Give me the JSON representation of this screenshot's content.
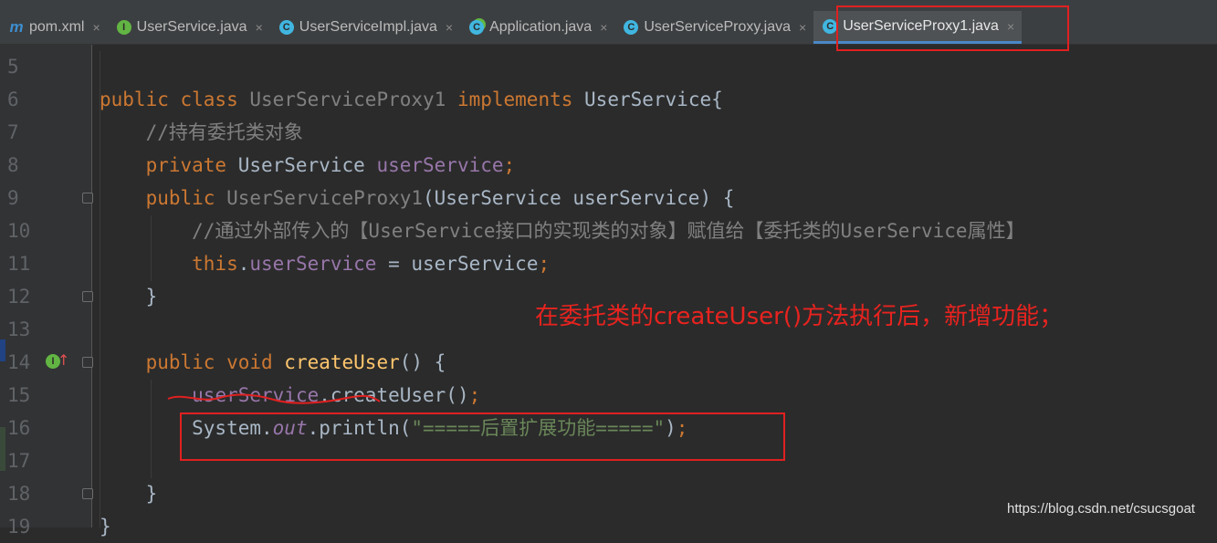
{
  "tabs": [
    {
      "label": "pom.xml",
      "icon": "maven-icon",
      "glyph": "m"
    },
    {
      "label": "UserService.java",
      "icon": "interface-icon",
      "glyph": "I"
    },
    {
      "label": "UserServiceImpl.java",
      "icon": "class-icon",
      "glyph": "C"
    },
    {
      "label": "Application.java",
      "icon": "spring-class-icon",
      "glyph": "C"
    },
    {
      "label": "UserServiceProxy.java",
      "icon": "class-icon",
      "glyph": "C"
    },
    {
      "label": "UserServiceProxy1.java",
      "icon": "class-icon",
      "glyph": "C"
    }
  ],
  "close_glyph": "×",
  "active_tab_index": 5,
  "line_numbers": [
    "5",
    "6",
    "7",
    "8",
    "9",
    "10",
    "11",
    "12",
    "13",
    "14",
    "15",
    "16",
    "17",
    "18",
    "19"
  ],
  "code": {
    "l6_a": "public class ",
    "l6_b": "UserServiceProxy1 ",
    "l6_c": "implements ",
    "l6_d": "UserService{",
    "l7": "    //持有委托类对象",
    "l8_a": "    private ",
    "l8_b": "UserService ",
    "l8_c": "userService",
    "l8_d": ";",
    "l9_a": "    public ",
    "l9_b": "UserServiceProxy1",
    "l9_c": "(UserService userService) {",
    "l10": "        //通过外部传入的【UserService接口的实现类的对象】赋值给【委托类的UserService属性】",
    "l11_a": "        this",
    "l11_b": ".",
    "l11_c": "userService",
    "l11_d": " = userService",
    "l11_e": ";",
    "l12": "    }",
    "l14_a": "    public void ",
    "l14_b": "createUser",
    "l14_c": "() {",
    "l15_a": "        ",
    "l15_b": "userService",
    "l15_c": ".createUser()",
    "l15_d": ";",
    "l16_a": "        System.",
    "l16_b": "out",
    "l16_c": ".println(",
    "l16_d": "\"=====后置扩展功能=====\"",
    "l16_e": ")",
    "l16_f": ";",
    "l18": "    }",
    "l19": "}"
  },
  "annotation": "在委托类的createUser()方法执行后，新增功能；",
  "impl_marker_glyph": "I",
  "impl_arrow_glyph": "↑",
  "watermark": "https://blog.csdn.net/csucsgoat",
  "colors": {
    "background": "#2b2b2b",
    "gutter": "#313335",
    "keyword": "#cc7832",
    "field": "#9876aa",
    "method": "#ffc66d",
    "string": "#6a8759",
    "comment": "#808080",
    "annotation_red": "#e02020"
  }
}
